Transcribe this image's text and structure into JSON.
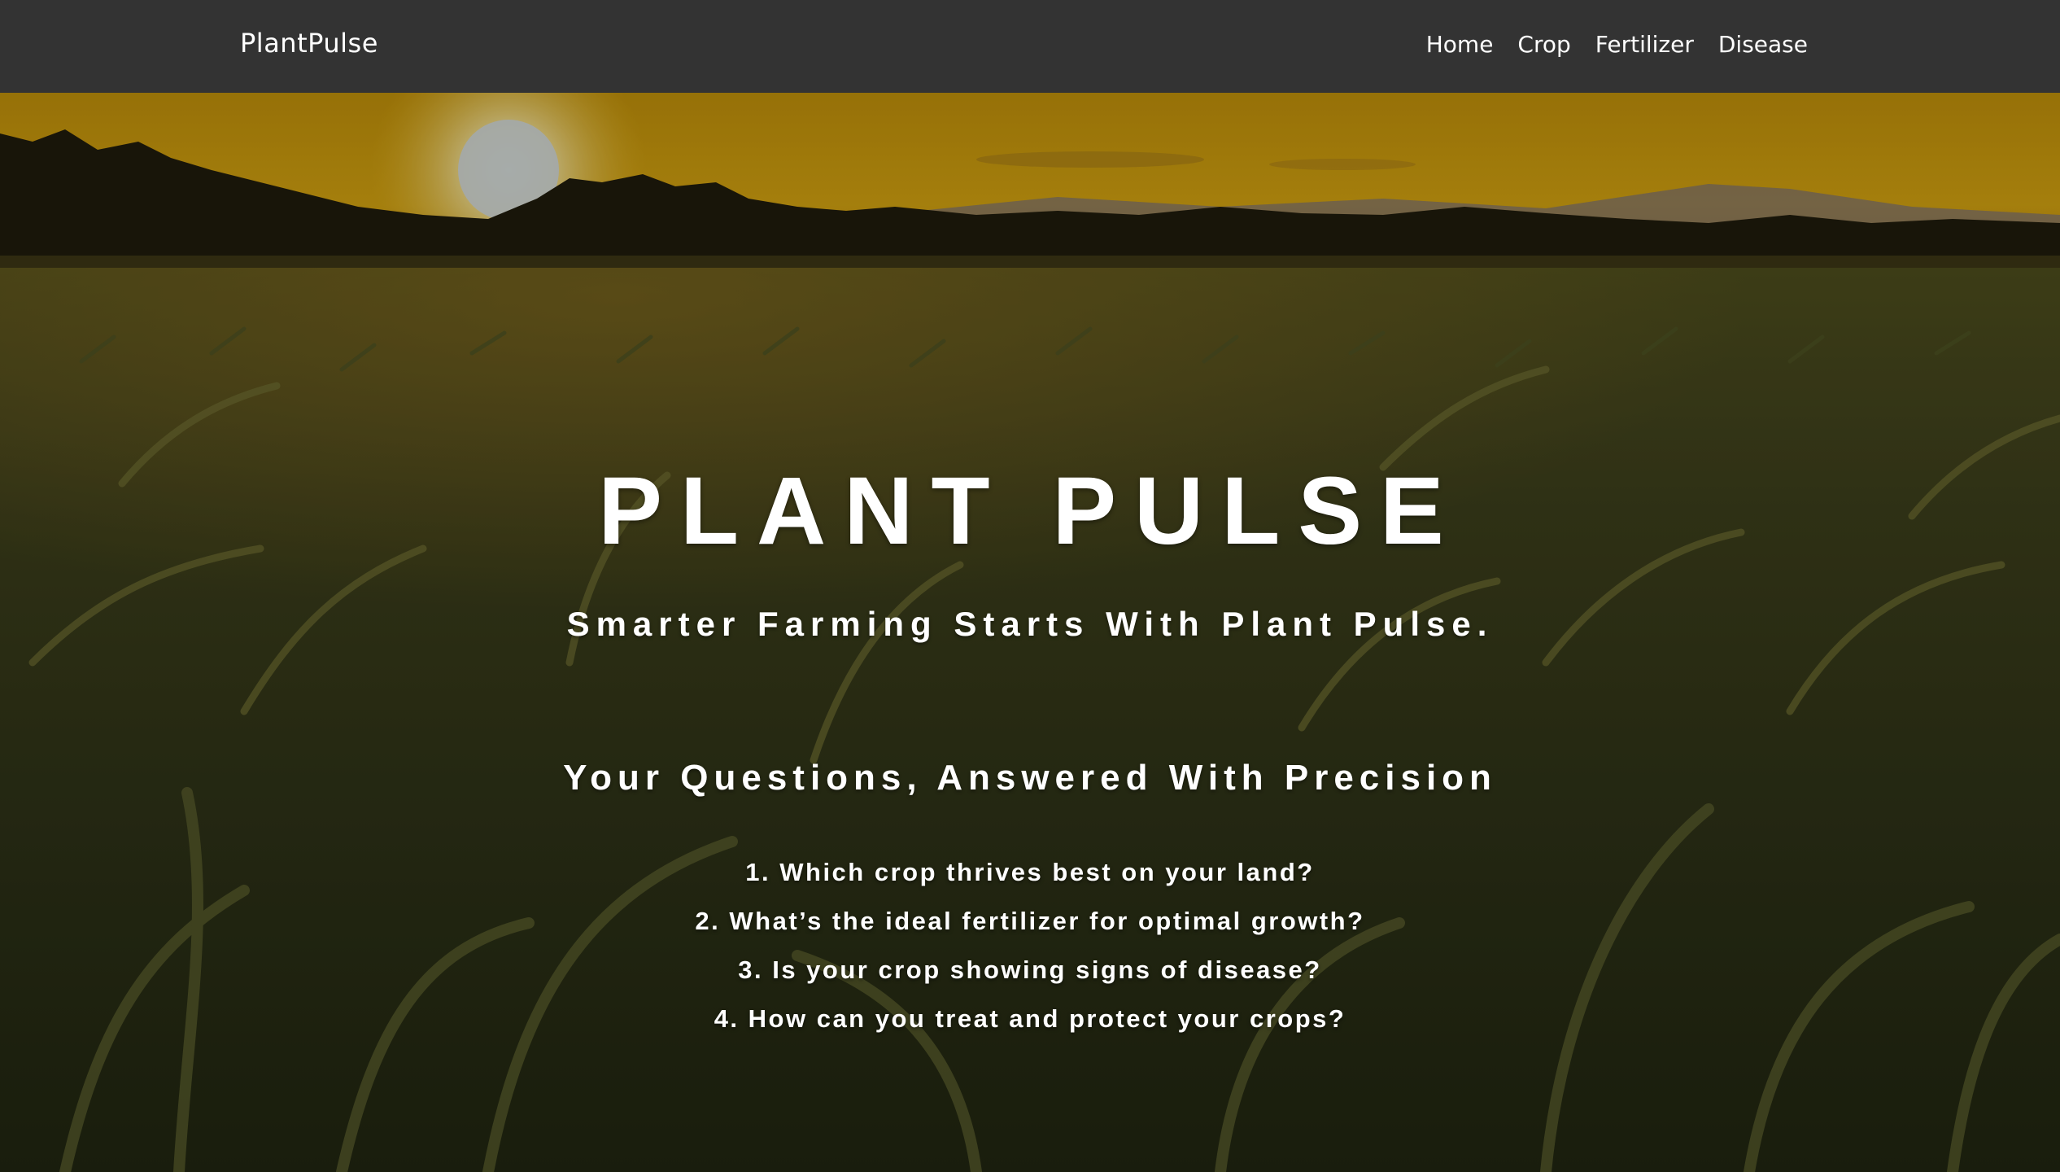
{
  "navbar": {
    "brand": "PlantPulse",
    "links": [
      "Home",
      "Crop",
      "Fertilizer",
      "Disease"
    ]
  },
  "hero": {
    "title": "PLANT PULSE",
    "subtitle": "Smarter Farming Starts With Plant Pulse.",
    "questions_heading": "Your Questions, Answered With Precision",
    "questions": [
      "1. Which crop thrives best on your land?",
      "2. What’s the ideal fertilizer for optimal growth?",
      "3. Is your crop showing signs of disease?",
      "4. How can you treat and protect your crops?"
    ]
  },
  "colors": {
    "navbar_bg": "#333333",
    "text": "#ffffff",
    "sky": "#c89a0c"
  }
}
